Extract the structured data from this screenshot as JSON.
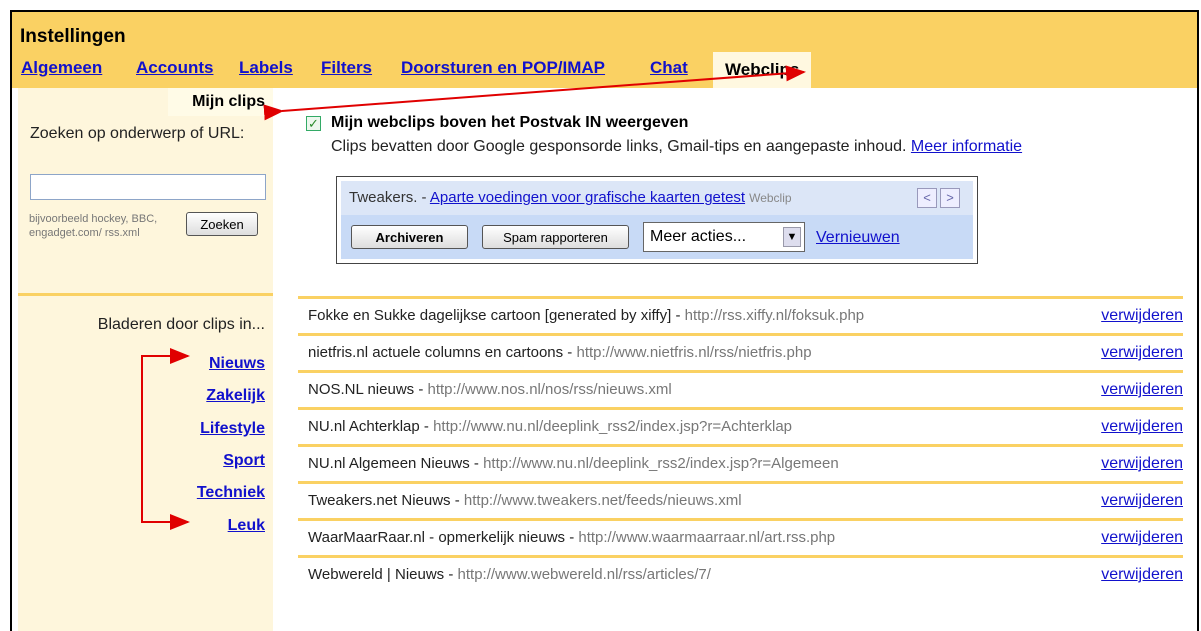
{
  "header": {
    "title": "Instellingen",
    "tabs": [
      {
        "label": "Algemeen"
      },
      {
        "label": "Accounts"
      },
      {
        "label": "Labels"
      },
      {
        "label": "Filters"
      },
      {
        "label": "Doorsturen en POP/IMAP"
      },
      {
        "label": "Chat"
      },
      {
        "label": "Webclips",
        "active": true
      }
    ]
  },
  "sidebar": {
    "mijn_clips": "Mijn clips",
    "search_label": "Zoeken op onderwerp of URL:",
    "search_value": "",
    "search_hint": "bijvoorbeeld hockey, BBC, engadget.com/ rss.xml",
    "search_button": "Zoeken",
    "browse_label": "Bladeren door clips in...",
    "categories": [
      "Nieuws",
      "Zakelijk",
      "Lifestyle",
      "Sport",
      "Techniek",
      "Leuk"
    ]
  },
  "main": {
    "checkbox_checked": true,
    "setting_label": "Mijn webclips boven het Postvak IN weergeven",
    "setting_desc": "Clips bevatten door Google gesponsorde links, Gmail-tips en aangepaste inhoud.",
    "more_info": "Meer informatie",
    "preview": {
      "source": "Tweakers.",
      "separator": " - ",
      "link": "Aparte voedingen voor grafische kaarten getest",
      "tag": "Webclip",
      "prev": "<",
      "next": ">",
      "archive_button": "Archiveren",
      "spam_button": "Spam rapporteren",
      "more_actions": "Meer acties...",
      "refresh": "Vernieuwen"
    },
    "remove_label": "verwijderen",
    "clips": [
      {
        "title": "Fokke en Sukke dagelijkse cartoon [generated by xiffy]",
        "url": "http://rss.xiffy.nl/foksuk.php"
      },
      {
        "title": "nietfris.nl actuele columns en cartoons",
        "url": "http://www.nietfris.nl/rss/nietfris.php"
      },
      {
        "title": "NOS.NL nieuws",
        "url": "http://www.nos.nl/nos/rss/nieuws.xml"
      },
      {
        "title": "NU.nl Achterklap",
        "url": "http://www.nu.nl/deeplink_rss2/index.jsp?r=Achterklap"
      },
      {
        "title": "NU.nl Algemeen Nieuws",
        "url": "http://www.nu.nl/deeplink_rss2/index.jsp?r=Algemeen"
      },
      {
        "title": "Tweakers.net Nieuws",
        "url": "http://www.tweakers.net/feeds/nieuws.xml"
      },
      {
        "title": "WaarMaarRaar.nl - opmerkelijk nieuws",
        "url": "http://www.waarmaarraar.nl/art.rss.php"
      },
      {
        "title": "Webwereld | Nieuws",
        "url": "http://www.webwereld.nl/rss/articles/7/"
      }
    ]
  },
  "colors": {
    "accent": "#fad163",
    "link": "#1111cc",
    "annotation": "#ff0000"
  }
}
